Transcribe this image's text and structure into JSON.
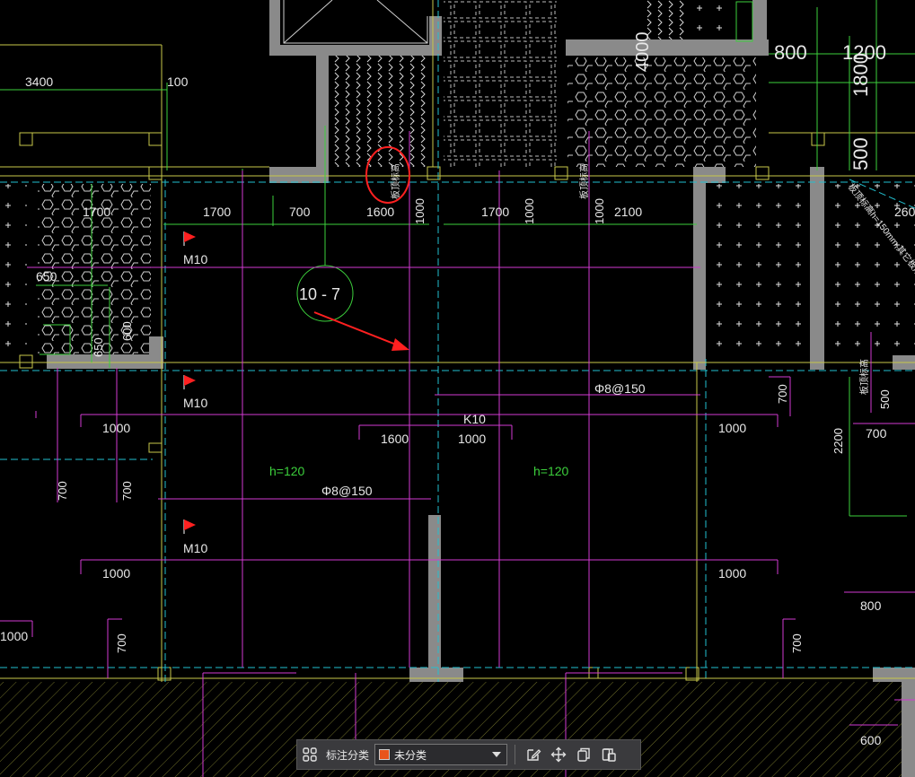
{
  "drawing": {
    "callout": "10 - 7",
    "slab_thickness_labels": [
      "h=120",
      "h=120"
    ],
    "rebar_labels": [
      "Φ8@150",
      "Φ8@150"
    ],
    "slab_code": "K10",
    "door_labels": [
      "M10",
      "M10",
      "M10"
    ],
    "vertical_notes": [
      "板顶标高",
      "板顶标高",
      "板顶标高"
    ],
    "diagonal_note": "板顶标高h=150mm,其它板厚",
    "dimensions": {
      "top_3400": "3400",
      "top_100": "100",
      "row_1700a": "1700",
      "row_1700b": "1700",
      "row_700": "700",
      "row_1600": "1600",
      "row_1000a": "1000",
      "row_1700c": "1700",
      "row_1000b": "1000",
      "row_1000c": "1000",
      "row_2100": "2100",
      "left_650": "650",
      "left_600": "600",
      "left_650b": "650",
      "mid_1000a": "1000",
      "mid_1600": "1600",
      "mid_1000b": "1000",
      "right_1000": "1000",
      "right_700": "700",
      "right_500": "500",
      "right_2200": "2200",
      "right_700b": "700",
      "low_1000a": "1000",
      "low_1000b": "1000",
      "right_800": "800",
      "v_700a": "700",
      "v_700b": "700",
      "v_700c": "700",
      "v_700d": "700",
      "bottom_600": "600",
      "left_edge_1000": "1000",
      "top_right_800": "800",
      "top_right_1200": "1200",
      "top_right_1800": "1800",
      "top_right_500": "500",
      "top_right_2600": "2600",
      "top_mid_4000": "4000"
    }
  },
  "toolbar": {
    "label": "标注分类",
    "selected_value": "未分类",
    "swatch_color": "#e8541c"
  }
}
